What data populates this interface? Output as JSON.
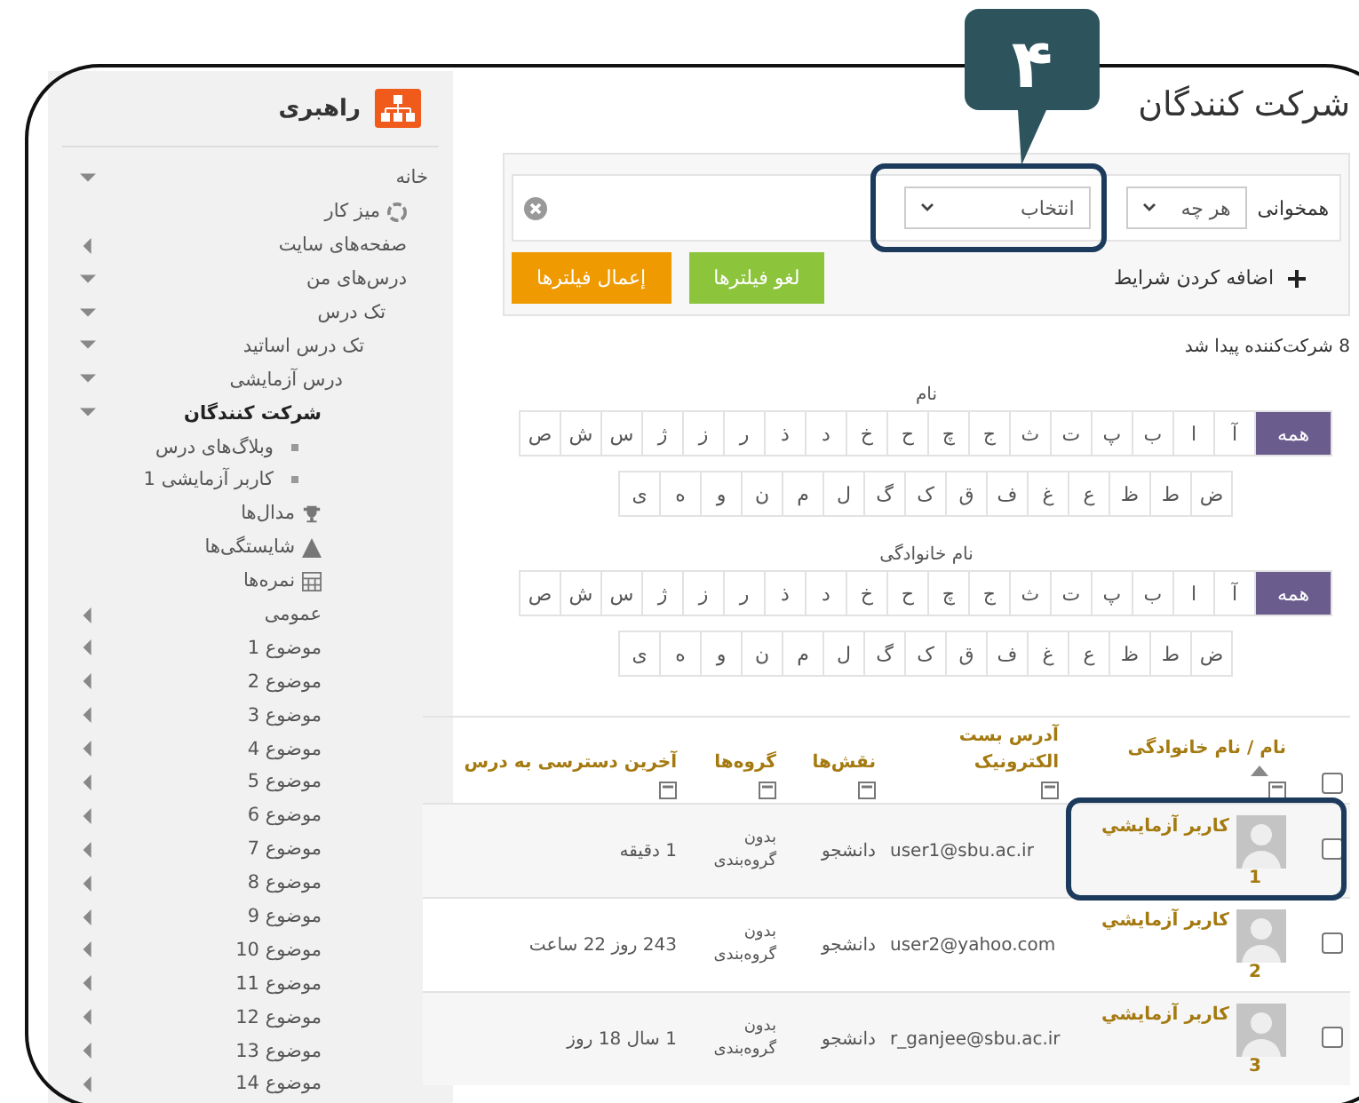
{
  "annotation": {
    "badge": "۴"
  },
  "sidebar": {
    "title": "راهبری",
    "items": [
      {
        "label": "خانه",
        "kind": "expanded",
        "current": false,
        "children": [
          {
            "label": "میز کار",
            "kind": "dashboard",
            "current": false
          },
          {
            "label": "صفحه‌های سایت",
            "kind": "collapsed",
            "current": false
          },
          {
            "label": "درس‌های من",
            "kind": "expanded",
            "current": false,
            "children": [
              {
                "label": "تک درس",
                "kind": "expanded",
                "current": false,
                "children": [
                  {
                    "label": "تک درس اساتید",
                    "kind": "expanded",
                    "current": false,
                    "children": [
                      {
                        "label": "درس آزمایشی",
                        "kind": "expanded",
                        "current": false,
                        "children": [
                          {
                            "label": "شرکت کنندگان",
                            "kind": "expanded",
                            "current": true,
                            "children": [
                              {
                                "label": "وبلاگ‌های درس",
                                "kind": "bullet",
                                "current": false
                              },
                              {
                                "label": "کاربر آزمایشی 1",
                                "kind": "bullet",
                                "current": false
                              }
                            ]
                          },
                          {
                            "label": "مدال‌ها",
                            "kind": "trophy",
                            "current": false
                          },
                          {
                            "label": "شایستگی‌ها",
                            "kind": "pyramid",
                            "current": false
                          },
                          {
                            "label": "نمره‌ها",
                            "kind": "grid",
                            "current": false
                          },
                          {
                            "label": "عمومی",
                            "kind": "collapsed",
                            "current": false
                          },
                          {
                            "label": "موضوع 1",
                            "kind": "collapsed",
                            "current": false
                          },
                          {
                            "label": "موضوع 2",
                            "kind": "collapsed",
                            "current": false
                          },
                          {
                            "label": "موضوع 3",
                            "kind": "collapsed",
                            "current": false
                          },
                          {
                            "label": "موضوع 4",
                            "kind": "collapsed",
                            "current": false
                          },
                          {
                            "label": "موضوع 5",
                            "kind": "collapsed",
                            "current": false
                          },
                          {
                            "label": "موضوع 6",
                            "kind": "collapsed",
                            "current": false
                          },
                          {
                            "label": "موضوع 7",
                            "kind": "collapsed",
                            "current": false
                          },
                          {
                            "label": "موضوع 8",
                            "kind": "collapsed",
                            "current": false
                          },
                          {
                            "label": "موضوع 9",
                            "kind": "collapsed",
                            "current": false
                          },
                          {
                            "label": "موضوع 10",
                            "kind": "collapsed",
                            "current": false
                          },
                          {
                            "label": "موضوع 11",
                            "kind": "collapsed",
                            "current": false
                          },
                          {
                            "label": "موضوع 12",
                            "kind": "collapsed",
                            "current": false
                          },
                          {
                            "label": "موضوع 13",
                            "kind": "collapsed",
                            "current": false
                          },
                          {
                            "label": "موضوع 14",
                            "kind": "collapsed",
                            "current": false
                          }
                        ]
                      }
                    ]
                  }
                ]
              }
            ]
          }
        ]
      }
    ]
  },
  "page_title": "شرکت کنندگان",
  "filters": {
    "match_label": "همخوانی",
    "match_value": "هر چه",
    "field_value": "انتخاب",
    "field_highlighted": true,
    "add_label": "اضافه کردن شرایط",
    "buttons": [
      {
        "label": "لغو فیلترها",
        "kind": "clear"
      },
      {
        "label": "إعمال فیلترها",
        "kind": "apply"
      }
    ]
  },
  "count": "8 شرکت‌کننده پیدا شد",
  "initials": [
    {
      "label": "نام",
      "rows": [
        [
          {
            "letter": "همه",
            "selected": true
          },
          {
            "letter": "آ",
            "selected": false
          },
          {
            "letter": "ا",
            "selected": false
          },
          {
            "letter": "ب",
            "selected": false
          },
          {
            "letter": "پ",
            "selected": false
          },
          {
            "letter": "ت",
            "selected": false
          },
          {
            "letter": "ث",
            "selected": false
          },
          {
            "letter": "ج",
            "selected": false
          },
          {
            "letter": "چ",
            "selected": false
          },
          {
            "letter": "ح",
            "selected": false
          },
          {
            "letter": "خ",
            "selected": false
          },
          {
            "letter": "د",
            "selected": false
          },
          {
            "letter": "ذ",
            "selected": false
          },
          {
            "letter": "ر",
            "selected": false
          },
          {
            "letter": "ز",
            "selected": false
          },
          {
            "letter": "ژ",
            "selected": false
          },
          {
            "letter": "س",
            "selected": false
          },
          {
            "letter": "ش",
            "selected": false
          },
          {
            "letter": "ص",
            "selected": false
          }
        ],
        [
          {
            "letter": "ض",
            "selected": false
          },
          {
            "letter": "ط",
            "selected": false
          },
          {
            "letter": "ظ",
            "selected": false
          },
          {
            "letter": "ع",
            "selected": false
          },
          {
            "letter": "غ",
            "selected": false
          },
          {
            "letter": "ف",
            "selected": false
          },
          {
            "letter": "ق",
            "selected": false
          },
          {
            "letter": "ک",
            "selected": false
          },
          {
            "letter": "گ",
            "selected": false
          },
          {
            "letter": "ل",
            "selected": false
          },
          {
            "letter": "م",
            "selected": false
          },
          {
            "letter": "ن",
            "selected": false
          },
          {
            "letter": "و",
            "selected": false
          },
          {
            "letter": "ه",
            "selected": false
          },
          {
            "letter": "ی",
            "selected": false
          }
        ]
      ]
    },
    {
      "label": "نام خانوادگی",
      "rows": [
        [
          {
            "letter": "همه",
            "selected": true
          },
          {
            "letter": "آ",
            "selected": false
          },
          {
            "letter": "ا",
            "selected": false
          },
          {
            "letter": "ب",
            "selected": false
          },
          {
            "letter": "پ",
            "selected": false
          },
          {
            "letter": "ت",
            "selected": false
          },
          {
            "letter": "ث",
            "selected": false
          },
          {
            "letter": "ج",
            "selected": false
          },
          {
            "letter": "چ",
            "selected": false
          },
          {
            "letter": "ح",
            "selected": false
          },
          {
            "letter": "خ",
            "selected": false
          },
          {
            "letter": "د",
            "selected": false
          },
          {
            "letter": "ذ",
            "selected": false
          },
          {
            "letter": "ر",
            "selected": false
          },
          {
            "letter": "ز",
            "selected": false
          },
          {
            "letter": "ژ",
            "selected": false
          },
          {
            "letter": "س",
            "selected": false
          },
          {
            "letter": "ش",
            "selected": false
          },
          {
            "letter": "ص",
            "selected": false
          }
        ],
        [
          {
            "letter": "ض",
            "selected": false
          },
          {
            "letter": "ط",
            "selected": false
          },
          {
            "letter": "ظ",
            "selected": false
          },
          {
            "letter": "ع",
            "selected": false
          },
          {
            "letter": "غ",
            "selected": false
          },
          {
            "letter": "ف",
            "selected": false
          },
          {
            "letter": "ق",
            "selected": false
          },
          {
            "letter": "ک",
            "selected": false
          },
          {
            "letter": "گ",
            "selected": false
          },
          {
            "letter": "ل",
            "selected": false
          },
          {
            "letter": "م",
            "selected": false
          },
          {
            "letter": "ن",
            "selected": false
          },
          {
            "letter": "و",
            "selected": false
          },
          {
            "letter": "ه",
            "selected": false
          },
          {
            "letter": "ی",
            "selected": false
          }
        ]
      ]
    }
  ],
  "table": {
    "select_all_checked": false,
    "columns": [
      "نام / نام خانوادگی",
      "آدرس بست الکترونیک",
      "نقش‌ها",
      "گروه‌ها",
      "آخرین دسترسی به درس"
    ],
    "rows": [
      {
        "checked": false,
        "highlighted": true,
        "name": "کاربر آزمایشي",
        "number": "1",
        "email": "user1@sbu.ac.ir",
        "role": "دانشجو",
        "group": "بدون گروه‌بندی",
        "last_access": "1 دقیقه"
      },
      {
        "checked": false,
        "highlighted": false,
        "name": "کاربر آزمایشي",
        "number": "2",
        "email": "user2@yahoo.com",
        "role": "دانشجو",
        "group": "بدون گروه‌بندی",
        "last_access": "243 روز 22 ساعت"
      },
      {
        "checked": false,
        "highlighted": false,
        "name": "کاربر آزمایشي",
        "number": "3",
        "email": "r_ganjee@sbu.ac.ir",
        "role": "دانشجو",
        "group": "بدون گروه‌بندی",
        "last_access": "1 سال 18 روز"
      }
    ]
  }
}
